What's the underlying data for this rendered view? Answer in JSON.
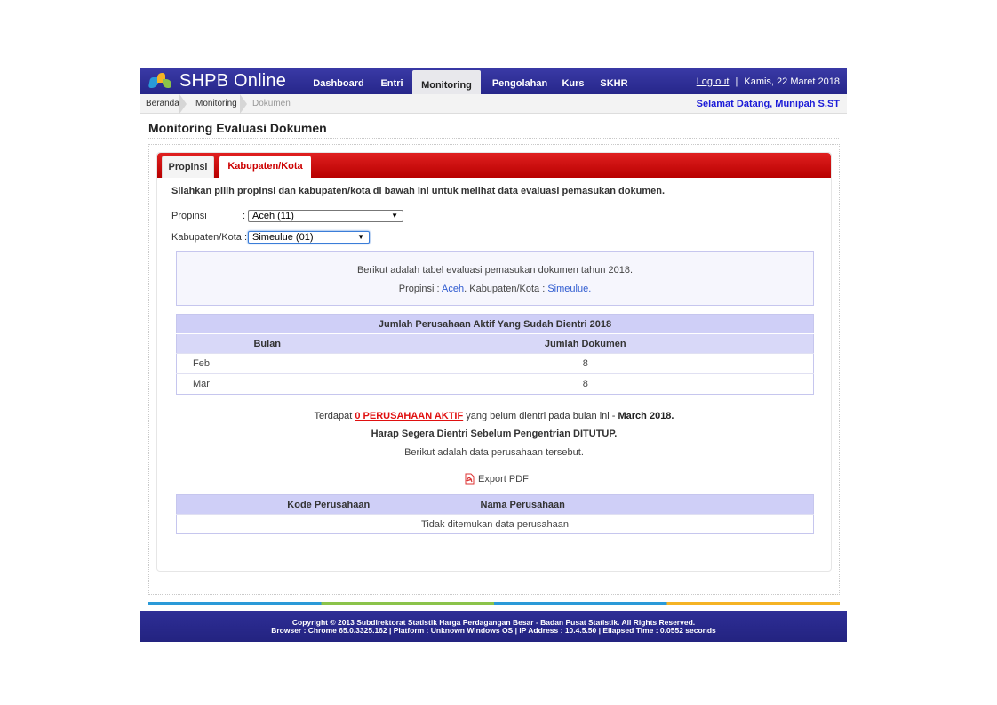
{
  "app": {
    "name": "SHPB Online"
  },
  "nav": {
    "items": [
      "Dashboard",
      "Entri",
      "Monitoring",
      "Pengolahan",
      "Kurs",
      "SKHR"
    ],
    "active": "Monitoring"
  },
  "topright": {
    "logout": "Log out",
    "separator": "|",
    "date": "Kamis, 22 Maret 2018"
  },
  "breadcrumb": {
    "items": [
      "Beranda",
      "Monitoring",
      "Dokumen"
    ]
  },
  "welcome": "Selamat Datang, Munipah S.ST",
  "page_title": "Monitoring Evaluasi Dokumen",
  "tabs": {
    "items": [
      "Propinsi",
      "Kabupaten/Kota"
    ],
    "active": "Kabupaten/Kota"
  },
  "instruction": "Silahkan pilih propinsi dan kabupaten/kota di bawah ini untuk melihat data evaluasi pemasukan dokumen.",
  "form": {
    "propinsi_label": "Propinsi",
    "propinsi_colon": ":",
    "propinsi_value": "Aceh (11)",
    "kab_label": "Kabupaten/Kota :",
    "kab_value": "Simeulue (01)"
  },
  "info": {
    "line1": "Berikut adalah tabel evaluasi pemasukan dokumen tahun 2018.",
    "propinsi_prefix": "Propinsi :",
    "propinsi_name": "Aceh",
    "kab_prefix": ". Kabupaten/Kota :",
    "kab_name": "Simeulue",
    "end": "."
  },
  "table1": {
    "caption": "Jumlah Perusahaan Aktif Yang Sudah Dientri 2018",
    "col_bulan": "Bulan",
    "col_jumlah": "Jumlah Dokumen",
    "rows": [
      {
        "bulan": "Feb",
        "jumlah": "8"
      },
      {
        "bulan": "Mar",
        "jumlah": "8"
      }
    ]
  },
  "notice": {
    "prefix": "Terdapat",
    "link": "0 PERUSAHAAN AKTIF",
    "middle": "yang belum dientri pada bulan ini -",
    "month": "March 2018.",
    "line2": "Harap Segera Dientri Sebelum Pengentrian DITUTUP.",
    "line3": "Berikut adalah data perusahaan tersebut."
  },
  "export": {
    "label": "Export PDF",
    "icon": "pdf-icon"
  },
  "table2": {
    "col_kode": "Kode Perusahaan",
    "col_nama": "Nama Perusahaan",
    "empty": "Tidak ditemukan data perusahaan"
  },
  "footer": {
    "line1": "Copyright © 2013 Subdirektorat Statistik Harga Perdagangan Besar - Badan Pusat Statistik. All Rights Reserved.",
    "line2": "Browser : Chrome 65.0.3325.162  |  Platform : Unknown Windows OS  |  IP Address : 10.4.5.50  |  Ellapsed Time : 0.0552 seconds"
  },
  "colors": {
    "nav_blue": "#2a2a94",
    "tab_red": "#cc0000",
    "welcome_blue": "#1b1bd8",
    "header_lavender": "#cfcff7"
  }
}
